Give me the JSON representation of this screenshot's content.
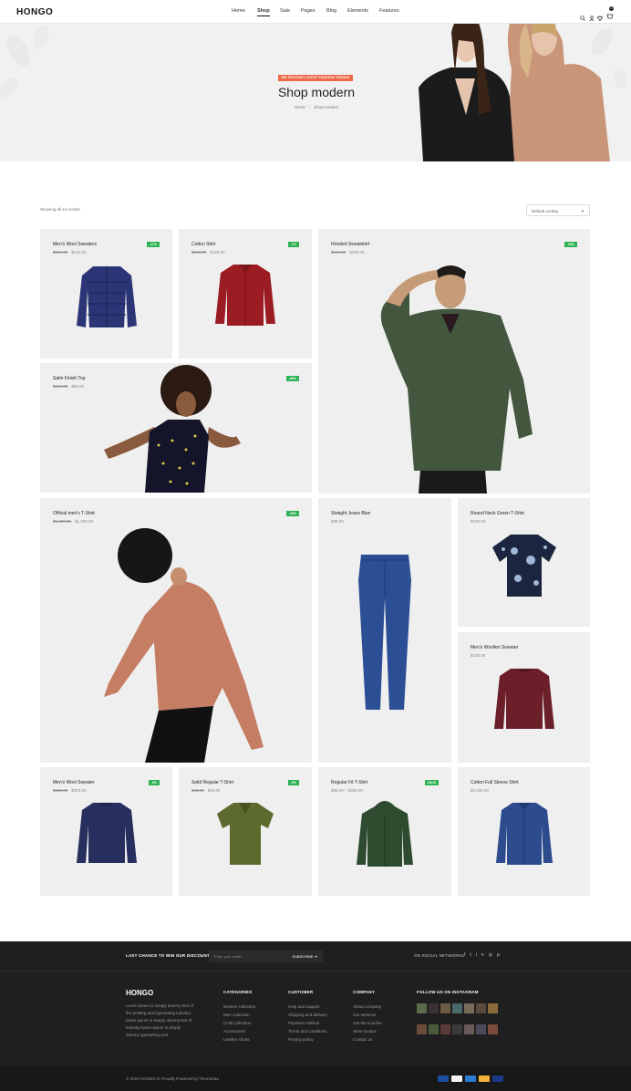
{
  "header": {
    "logo": "HONGO",
    "nav": [
      "Home",
      "Shop",
      "Sale",
      "Pages",
      "Blog",
      "Elements",
      "Features"
    ],
    "active_nav": "Shop",
    "cart_count": "0"
  },
  "hero": {
    "badge": "WE PROVIDE LATEST FASHION TRENDS",
    "title": "Shop modern",
    "breadcrumb_home": "Home",
    "breadcrumb_sep": "|",
    "breadcrumb_current": "Shop modern"
  },
  "listing": {
    "results": "Showing all 12 results",
    "sort": "Default sorting"
  },
  "products": [
    {
      "name": "Men's Wool Sweaters",
      "old_price": "$150.00",
      "price": "$115.00",
      "discount": "-17%"
    },
    {
      "name": "Cotton Shirt",
      "old_price": "$150.00",
      "price": "$140.00",
      "discount": "-7%"
    },
    {
      "name": "Hooded Sweatshirt",
      "old_price": "$150.00",
      "price": "$100.00",
      "discount": "-33%"
    },
    {
      "name": "Satin Finish Top",
      "old_price": "$150.00",
      "price": "$50.00",
      "discount": "-66%"
    },
    {
      "name": "Official men's T-Shirt",
      "old_price": "$1,800.00",
      "price": "$1,200.00",
      "discount": "-33%"
    },
    {
      "name": "Straight Jeans Blue",
      "old_price": "",
      "price": "$95.00",
      "discount": ""
    },
    {
      "name": "Round Neck Green T-Shirt",
      "old_price": "",
      "price": "$100.00",
      "discount": ""
    },
    {
      "name": "Men's Woollen Sweater",
      "old_price": "",
      "price": "$100.00",
      "discount": ""
    },
    {
      "name": "Men's Wool Sweater",
      "old_price": "$410.00",
      "price": "$300.00",
      "discount": "-5%"
    },
    {
      "name": "Solid Regular T-Shirt",
      "old_price": "$42.00",
      "price": "$40.00",
      "discount": "-5%"
    },
    {
      "name": "Regular Fit T-Shirt",
      "old_price": "",
      "price": "$95.00 – $380.00",
      "discount": "SALE"
    },
    {
      "name": "Cotton Full Sleeve Shirt",
      "old_price": "",
      "price": "$4,000.00",
      "discount": ""
    }
  ],
  "footer": {
    "newsletter_label": "LAST CHANCE TO WIN OUR DISCOUNT!",
    "email_placeholder": "Enter your email...",
    "subscribe": "SUBSCRIBE",
    "social_label": "ON SOCIAL NETWORKS",
    "logo": "HONGO",
    "about": [
      "Lorem ipsum is simply dummy text of",
      "the printing and typesetting industry.",
      "lorem ipsum is simply dummy text of",
      "industry lorem ipsum is simply",
      "dummy typesetting text."
    ],
    "categories_title": "CATEGORIES",
    "categories": [
      "Women collection",
      "Men collection",
      "Child collection",
      "Accessories",
      "Leather shoes"
    ],
    "customer_title": "CUSTOMER",
    "customer": [
      "Help and support",
      "Shipping and delivery",
      "Payment method",
      "Terms and conditions",
      "Privacy policy"
    ],
    "company_title": "COMPANY",
    "company": [
      "About company",
      "Our services",
      "Get the voucher",
      "Store locator",
      "Contact us"
    ],
    "instagram_title": "FOLLOW US ON INSTAGRAM",
    "copyright": "© 2019 HONGO is Proudly Powered by ThemeZaa"
  },
  "colors": {
    "accent": "#f26a4a",
    "discount_badge": "#2eb354",
    "footer_bg": "#1f1f1f"
  }
}
